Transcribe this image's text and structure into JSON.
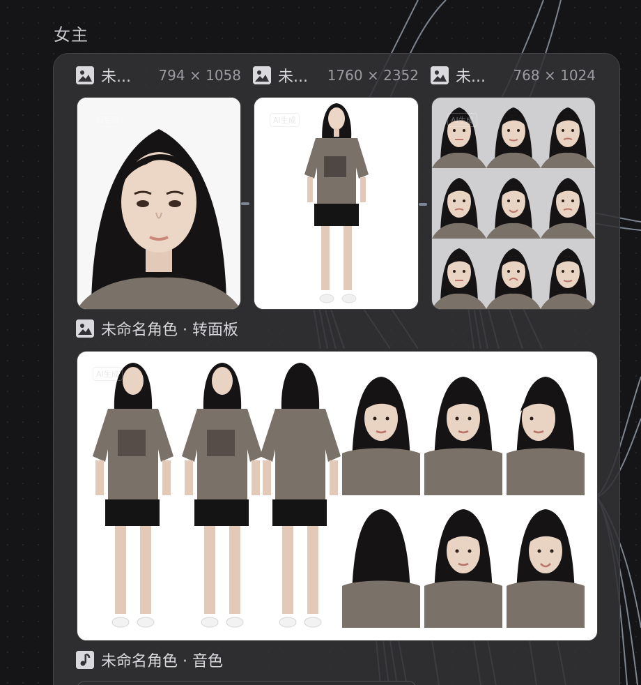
{
  "group": {
    "title": "女主"
  },
  "nodes": [
    {
      "name": "未...",
      "size": "794 × 1058",
      "icon": "image-icon",
      "watermark": "AI生成"
    },
    {
      "name": "未...",
      "size": "1760 × 2352",
      "icon": "image-icon",
      "watermark": "AI生成"
    },
    {
      "name": "未...",
      "size": "768 × 1024",
      "icon": "image-icon",
      "watermark": "AI生成"
    }
  ],
  "turnaround": {
    "title": "未命名角色 · 转面板",
    "icon": "image-icon",
    "watermark": "AI生成"
  },
  "voice": {
    "title": "未命名角色 · 音色",
    "icon": "music-note-icon"
  },
  "colors": {
    "canvas": "#151517",
    "panel": "#323235",
    "wire": "#8f99a6",
    "shirt": "#7a7168",
    "hair": "#151314",
    "skin": "#e9d3c3"
  }
}
